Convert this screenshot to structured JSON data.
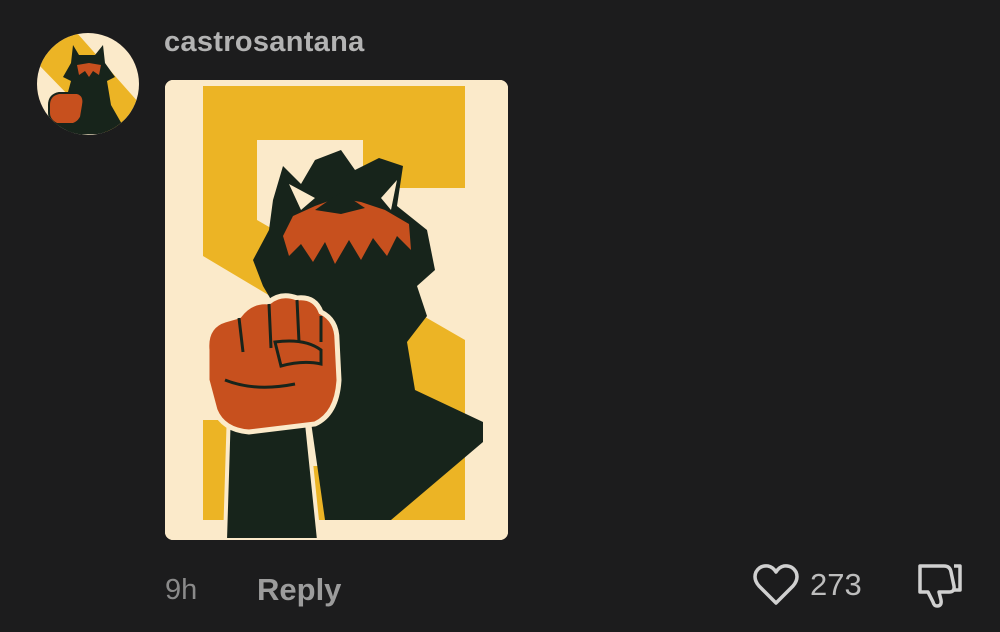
{
  "comment": {
    "username": "castrosantana",
    "timestamp": "9h",
    "reply_label": "Reply",
    "like_count": "273"
  },
  "icons": {
    "like": "heart-outline-icon",
    "dislike": "thumbs-down-outline-icon"
  },
  "colors": {
    "background": "#1c1c1d",
    "username": "#b3b3b3",
    "artwork_background": "#fbeaca",
    "artwork_yellow": "#ecb425",
    "artwork_dark": "#17241b",
    "artwork_orange": "#c7501e"
  }
}
